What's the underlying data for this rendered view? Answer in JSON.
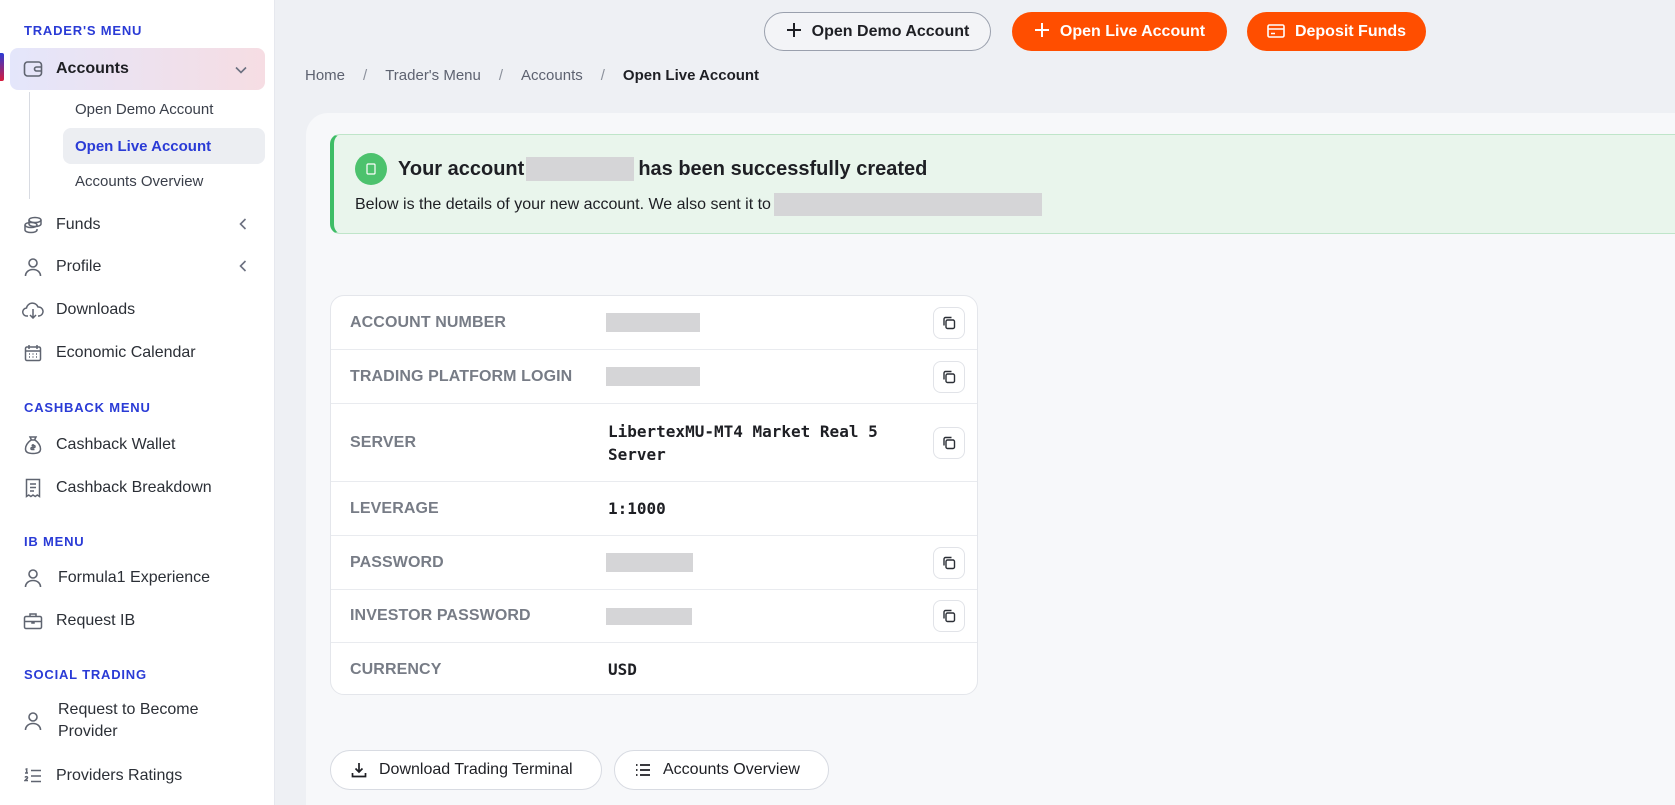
{
  "sidebar": {
    "traders_menu_title": "TRADER'S MENU",
    "accounts": {
      "label": "Accounts",
      "icon": "wallet-icon"
    },
    "accounts_sub": [
      "Open Demo Account",
      "Open Live Account",
      "Accounts Overview"
    ],
    "funds": {
      "label": "Funds",
      "icon": "coins-icon"
    },
    "profile": {
      "label": "Profile",
      "icon": "user-icon"
    },
    "downloads": {
      "label": "Downloads",
      "icon": "cloud-download-icon"
    },
    "economic_calendar": {
      "label": "Economic Calendar",
      "icon": "calendar-icon"
    },
    "cashback_menu_title": "CASHBACK MENU",
    "cashback_wallet": {
      "label": "Cashback Wallet",
      "icon": "money-bag-icon"
    },
    "cashback_breakdown": {
      "label": "Cashback Breakdown",
      "icon": "receipt-icon"
    },
    "ib_menu_title": "IB MENU",
    "formula1": {
      "label": "Formula1 Experience",
      "icon": "user-icon"
    },
    "request_ib": {
      "label": "Request IB",
      "icon": "briefcase-icon"
    },
    "social_trading_title": "SOCIAL TRADING",
    "request_provider": {
      "label": "Request to Become Provider",
      "icon": "user-icon"
    },
    "providers_ratings": {
      "label": "Providers Ratings",
      "icon": "list-numbered-icon"
    }
  },
  "topbar": {
    "open_demo": "Open Demo Account",
    "open_live": "Open Live Account",
    "deposit": "Deposit Funds"
  },
  "breadcrumb": [
    "Home",
    "Trader's Menu",
    "Accounts",
    "Open Live Account"
  ],
  "alert": {
    "title_before": "Your account",
    "title_after": "has been successfully created",
    "text": "Below is the details of your new account. We also sent it to"
  },
  "details": [
    {
      "label": "ACCOUNT NUMBER",
      "value": "",
      "redacted": true,
      "copy": true
    },
    {
      "label": "TRADING PLATFORM LOGIN",
      "value": "",
      "redacted": true,
      "copy": true
    },
    {
      "label": "SERVER",
      "value": "LibertexMU-MT4 Market Real 5 Server",
      "redacted": false,
      "copy": true
    },
    {
      "label": "LEVERAGE",
      "value": "1:1000",
      "redacted": false,
      "copy": false
    },
    {
      "label": "PASSWORD",
      "value": "",
      "redacted": true,
      "copy": true
    },
    {
      "label": "INVESTOR PASSWORD",
      "value": "",
      "redacted": true,
      "copy": true
    },
    {
      "label": "CURRENCY",
      "value": "USD",
      "redacted": false,
      "copy": false
    }
  ],
  "bottom": {
    "download_terminal": "Download Trading Terminal",
    "accounts_overview": "Accounts Overview"
  },
  "colors": {
    "accent": "#2a3bd6",
    "orange": "#ff4e00",
    "success": "#4cc26d"
  }
}
